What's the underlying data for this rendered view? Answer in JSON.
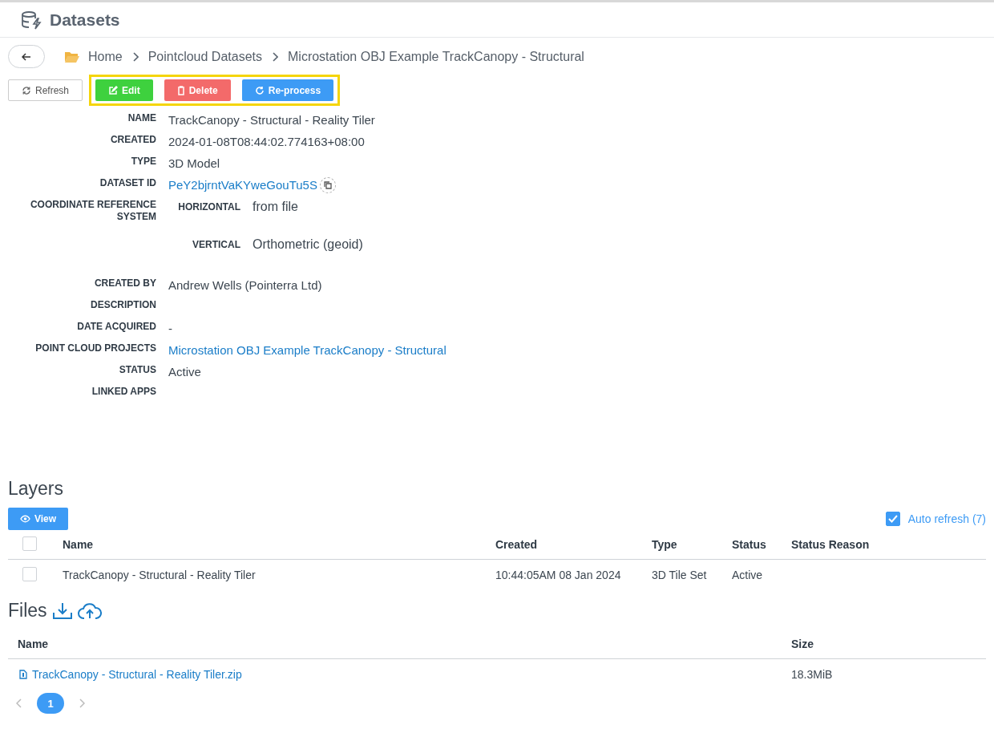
{
  "header": {
    "title": "Datasets"
  },
  "breadcrumb": [
    "Home",
    "Pointcloud Datasets",
    "Microstation OBJ Example TrackCanopy - Structural"
  ],
  "toolbar": {
    "refresh": "Refresh",
    "actions": [
      {
        "label": "Edit",
        "kind": "edit"
      },
      {
        "label": "Delete",
        "kind": "delete"
      },
      {
        "label": "Re-process",
        "kind": "reprocess"
      }
    ]
  },
  "details": [
    {
      "label": "NAME",
      "kind": "text",
      "value": "TrackCanopy - Structural - Reality Tiler"
    },
    {
      "label": "CREATED",
      "kind": "text",
      "value": "2024-01-08T08:44:02.774163+08:00"
    },
    {
      "label": "TYPE",
      "kind": "text",
      "value": "3D Model"
    },
    {
      "label": "DATASET ID",
      "kind": "id",
      "value": "PeY2bjrntVaKYweGouTu5S"
    },
    {
      "label": "COORDINATE REFERENCE SYSTEM",
      "kind": "crs",
      "parts": [
        {
          "label": "HORIZONTAL",
          "value": "from file"
        },
        {
          "label": "VERTICAL",
          "value": "Orthometric (geoid)"
        }
      ]
    },
    {
      "label": "CREATED BY",
      "kind": "text",
      "value": "Andrew Wells (Pointerra Ltd)"
    },
    {
      "label": "DESCRIPTION",
      "kind": "text"
    },
    {
      "label": "DATE ACQUIRED",
      "kind": "text",
      "value": "-"
    },
    {
      "label": "POINT CLOUD PROJECTS",
      "kind": "link",
      "value": "Microstation OBJ Example TrackCanopy - Structural"
    },
    {
      "label": "STATUS",
      "kind": "text",
      "value": "Active"
    },
    {
      "label": "LINKED APPS",
      "kind": "text"
    }
  ],
  "layers": {
    "title": "Layers",
    "view_button": "View",
    "auto_refresh": {
      "label": "Auto refresh (7)",
      "checked": true
    },
    "header_checked": false,
    "columns": [
      "Name",
      "Created",
      "Type",
      "Status",
      "Status Reason"
    ],
    "rows": [
      {
        "checked": false,
        "cells": [
          "TrackCanopy - Structural - Reality Tiler",
          "10:44:05AM 08 Jan 2024",
          "3D Tile Set",
          "Active"
        ]
      }
    ]
  },
  "files": {
    "title": "Files",
    "columns": [
      "Name",
      "Size"
    ],
    "rows": [
      {
        "name": "TrackCanopy - Structural - Reality Tiler.zip",
        "size": "18.3MiB"
      }
    ],
    "pages": [
      {
        "label": "1",
        "selected": true
      }
    ]
  }
}
